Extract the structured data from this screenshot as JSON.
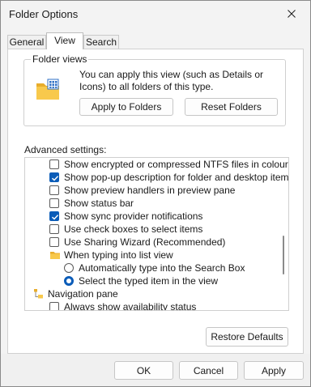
{
  "window": {
    "title": "Folder Options",
    "close_icon": "close-icon"
  },
  "tabs": [
    {
      "label": "General",
      "active": false
    },
    {
      "label": "View",
      "active": true
    },
    {
      "label": "Search",
      "active": false
    }
  ],
  "folder_views": {
    "legend": "Folder views",
    "icon": "folder-view-icon",
    "description": "You can apply this view (such as Details or Icons) to all folders of this type.",
    "apply_button": "Apply to Folders",
    "reset_button": "Reset Folders"
  },
  "advanced": {
    "label": "Advanced settings:",
    "items": [
      {
        "type": "checkbox",
        "label": "Show encrypted or compressed NTFS files in colour",
        "checked": false
      },
      {
        "type": "checkbox",
        "label": "Show pop-up description for folder and desktop items",
        "checked": true
      },
      {
        "type": "checkbox",
        "label": "Show preview handlers in preview pane",
        "checked": false
      },
      {
        "type": "checkbox",
        "label": "Show status bar",
        "checked": false
      },
      {
        "type": "checkbox",
        "label": "Show sync provider notifications",
        "checked": true
      },
      {
        "type": "checkbox",
        "label": "Use check boxes to select items",
        "checked": false
      },
      {
        "type": "checkbox",
        "label": "Use Sharing Wizard (Recommended)",
        "checked": false
      },
      {
        "type": "folder",
        "label": "When typing into list view",
        "icon": "folder-icon"
      },
      {
        "type": "radio",
        "label": "Automatically type into the Search Box",
        "checked": false
      },
      {
        "type": "radio",
        "label": "Select the typed item in the view",
        "checked": true
      },
      {
        "type": "navpane",
        "label": "Navigation pane",
        "icon": "navigation-pane-icon"
      },
      {
        "type": "checkbox",
        "label": "Always show availability status",
        "checked": false
      }
    ]
  },
  "restore_button": "Restore Defaults",
  "footer": {
    "ok": "OK",
    "cancel": "Cancel",
    "apply": "Apply"
  },
  "colors": {
    "accent": "#0a5cb8",
    "window_bg": "#f3f3f3",
    "content_bg": "#ffffff",
    "folder": "#f4c54d"
  }
}
